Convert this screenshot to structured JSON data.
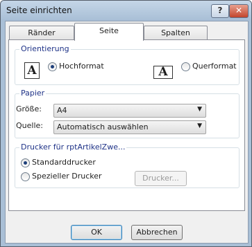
{
  "window": {
    "title": "Seite einrichten"
  },
  "titlebar_buttons": {
    "help": "?",
    "close": "✕"
  },
  "tabs": [
    {
      "label": "Ränder",
      "active": false
    },
    {
      "label": "Seite",
      "active": true
    },
    {
      "label": "Spalten",
      "active": false
    }
  ],
  "orientation": {
    "group_label": "Orientierung",
    "portrait_label": "Hochformat",
    "landscape_label": "Querformat",
    "portrait_icon": "A",
    "landscape_icon": "A",
    "selected": "portrait"
  },
  "paper": {
    "group_label": "Papier",
    "size_label": "Größe:",
    "size_value": "A4",
    "source_label": "Quelle:",
    "source_value": "Automatisch auswählen"
  },
  "printer": {
    "group_label": "Drucker für rptArtikelZwe...",
    "default_label": "Standarddrucker",
    "specific_label": "Spezieller Drucker",
    "printer_button": "Drucker...",
    "selected": "default"
  },
  "footer": {
    "ok": "OK",
    "cancel": "Abbrechen"
  }
}
